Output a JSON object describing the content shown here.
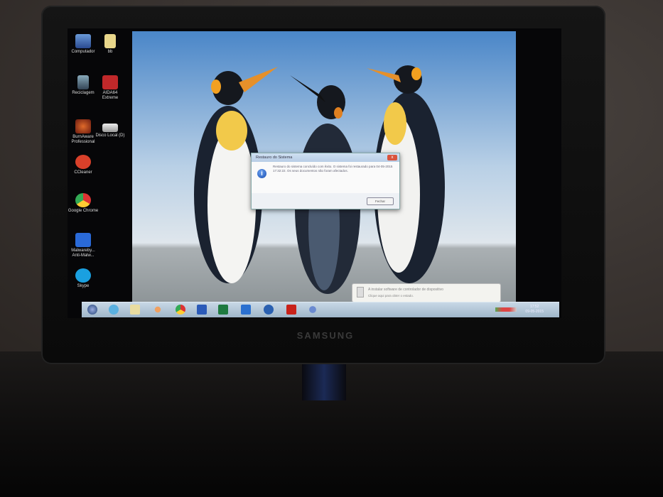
{
  "desktop_icons": [
    {
      "label": "Computador",
      "icon": "computer-icon"
    },
    {
      "label": "bb",
      "icon": "folder-icon"
    },
    {
      "label": "Reciclagem",
      "icon": "recycle-bin-icon"
    },
    {
      "label": "AIDA64 Extreme",
      "icon": "aida64-icon"
    },
    {
      "label": "BurnAware Professional",
      "icon": "burnaware-icon"
    },
    {
      "label": "Disco Local (D)",
      "icon": "drive-icon"
    },
    {
      "label": "CCleaner",
      "icon": "ccleaner-icon"
    },
    {
      "label": "Google Chrome",
      "icon": "chrome-icon"
    },
    {
      "label": "Malwareby... Anti-Malw...",
      "icon": "malwarebytes-icon"
    },
    {
      "label": "Skype",
      "icon": "skype-icon"
    }
  ],
  "dialog": {
    "title": "Restauro do Sistema",
    "message": "Restauro do sistema concluído com êxito. O sistema foi restaurado para 04-05-2015 17:32:22. Os seus documentos não foram afectados.",
    "close_button": "Fechar",
    "close_glyph": "x"
  },
  "balloon": {
    "title": "A instalar software de controlador de dispositivo",
    "subtitle": "Clique aqui para obter o estado."
  },
  "taskbar": {
    "items": [
      "start",
      "internet-explorer",
      "file-explorer",
      "media-player",
      "chrome",
      "word",
      "excel",
      "outlook",
      "onedrive",
      "acrobat",
      "network-tool"
    ],
    "clock_time": "17:52",
    "clock_date": "09-05-2015"
  },
  "monitor_brand": "SAMSUNG"
}
